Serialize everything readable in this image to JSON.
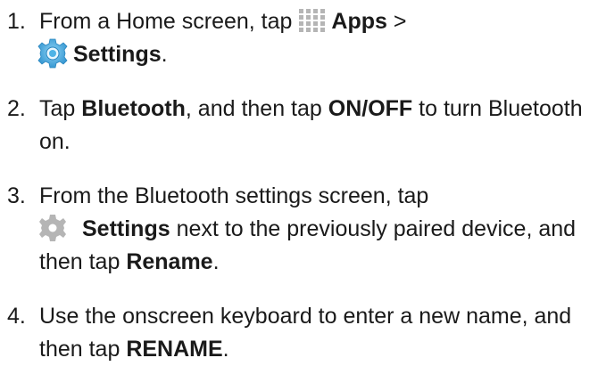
{
  "steps": [
    {
      "number": "1.",
      "parts": {
        "a": "From a Home screen, tap ",
        "b": "Apps",
        "c": " >",
        "d": "Settings",
        "e": "."
      },
      "icons": [
        "apps-grid-icon",
        "settings-app-icon"
      ]
    },
    {
      "number": "2.",
      "parts": {
        "a": "Tap ",
        "b": "Bluetooth",
        "c": ", and then tap ",
        "d": "ON/OFF",
        "e": " to turn Bluetooth on."
      }
    },
    {
      "number": "3.",
      "parts": {
        "a": "From the Bluetooth settings screen, tap ",
        "b": "Settings",
        "c": " next to the previously paired device, and then tap ",
        "d": "Rename",
        "e": "."
      },
      "icons": [
        "gear-icon"
      ]
    },
    {
      "number": "4.",
      "parts": {
        "a": "Use the onscreen keyboard to enter a new name, and then tap ",
        "b": "RENAME",
        "c": "."
      }
    }
  ],
  "colors": {
    "text": "#1a1a1a",
    "icon_gray": "#b5b5b5",
    "settings_icon_blue": "#4fb3e6"
  }
}
